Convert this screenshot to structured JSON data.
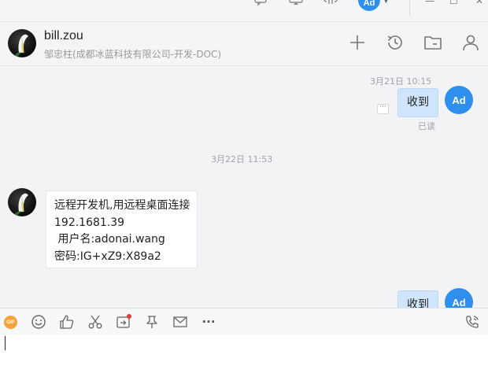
{
  "header": {
    "name": "bill.zou",
    "subtitle": "邹忠柱(成都冰蓝科技有限公司-开发-DOC)"
  },
  "topbar": {
    "user_initials": "Ad"
  },
  "messages": [
    {
      "direction": "outgoing",
      "timestamp": "3月21日 10:15",
      "text": "收到",
      "status": "已读",
      "avatar": "Ad"
    },
    {
      "direction": "divider",
      "timestamp": "3月22日 11:53"
    },
    {
      "direction": "incoming",
      "lines": [
        "远程开发机,用远程桌面连接",
        "192.1681.39",
        " 用户名:adonai.wang",
        "密码:IG+xZ9:X89a2"
      ]
    },
    {
      "direction": "outgoing",
      "text": "收到",
      "avatar": "Ad"
    }
  ],
  "toolbar": {
    "gif_label": "GIF",
    "more_label": "···"
  },
  "icons": {
    "titlebar": [
      "chat-bubble-icon",
      "screen-icon",
      "cloud-sync-icon",
      "minimize-icon",
      "maximize-icon",
      "close-icon"
    ],
    "header": [
      "add-icon",
      "history-icon",
      "folder-icon",
      "profile-icon"
    ],
    "toolbar": [
      "gif-icon",
      "emoji-icon",
      "thumbs-up-icon",
      "scissors-icon",
      "screen-share-icon",
      "pin-icon",
      "mail-icon",
      "more-icon",
      "phone-icon"
    ]
  },
  "colors": {
    "accent": "#2f8fef",
    "outgoing_bubble": "#cfe5fb",
    "incoming_bubble": "#ffffff",
    "background": "#f2f3f5"
  }
}
